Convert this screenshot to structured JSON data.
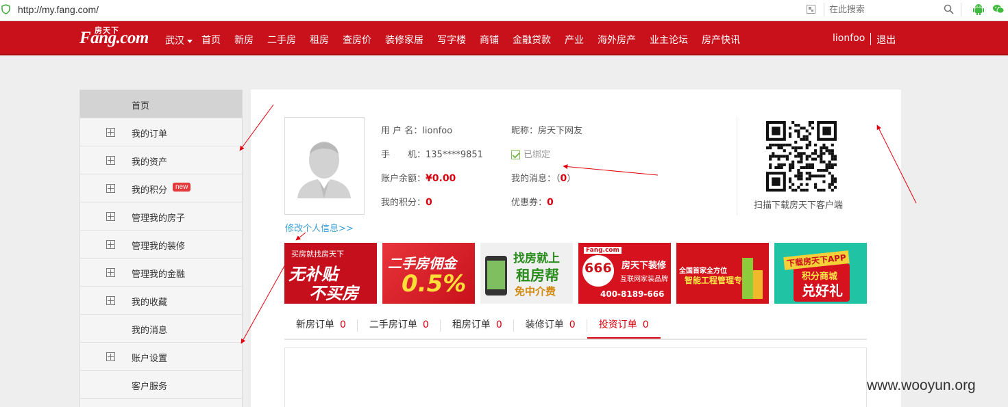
{
  "browser": {
    "url": "http://my.fang.com/",
    "search_placeholder": "在此搜索"
  },
  "header": {
    "logo_top": "房天下",
    "logo_main": "Fang.com",
    "city": "武汉",
    "nav": [
      "首页",
      "新房",
      "二手房",
      "租房",
      "查房价",
      "装修家居",
      "写字楼",
      "商铺",
      "金融贷款",
      "产业",
      "海外房产",
      "业主论坛",
      "房产快讯"
    ],
    "username": "lionfoo",
    "logout": "退出"
  },
  "sidebar": {
    "items": [
      {
        "label": "首页",
        "expandable": false,
        "active": true
      },
      {
        "label": "我的订单",
        "expandable": true
      },
      {
        "label": "我的资产",
        "expandable": true
      },
      {
        "label": "我的积分",
        "expandable": true,
        "badge": "new"
      },
      {
        "label": "管理我的房子",
        "expandable": true
      },
      {
        "label": "管理我的装修",
        "expandable": true
      },
      {
        "label": "管理我的金融",
        "expandable": true
      },
      {
        "label": "我的收藏",
        "expandable": true
      },
      {
        "label": "我的消息",
        "expandable": false
      },
      {
        "label": "账户设置",
        "expandable": true
      },
      {
        "label": "客户服务",
        "expandable": false
      }
    ]
  },
  "profile": {
    "username_label": "用 户 名：",
    "username": "lionfoo",
    "nickname_label": "昵称：",
    "nickname": "房天下网友",
    "phone_label": "手　　机：",
    "phone": "135****9851",
    "bound": "已绑定",
    "balance_label": "账户余额：",
    "balance": "¥0.00",
    "messages_label": "我的消息：",
    "messages_open": "（",
    "messages_count": "0",
    "messages_close": "）",
    "points_label": "我的积分：",
    "points": "0",
    "coupons_label": "优惠券：",
    "coupons": "0",
    "edit_link": "修改个人信息>>",
    "qr_caption": "扫描下载房天下客户端"
  },
  "banners": [
    {
      "line1": "买房就找房天下",
      "line2": "无补贴",
      "line3": "不买房"
    },
    {
      "line1": "二手房佣金",
      "line2": "0.5%"
    },
    {
      "line1": "找房就上",
      "line2": "租房帮",
      "line3": "免中介费"
    },
    {
      "line1": "Fang.com",
      "line2": "666",
      "line3": "房天下装修",
      "line4": "互联网家装品牌",
      "line5": "400-8189-666"
    },
    {
      "line1": "全国首家全方位",
      "line2": "智能工程管理专家"
    },
    {
      "line1": "下载房天下APP",
      "line2": "积分商城",
      "line3": "兑好礼"
    }
  ],
  "order_tabs": [
    {
      "label": "新房订单",
      "count": "0"
    },
    {
      "label": "二手房订单",
      "count": "0"
    },
    {
      "label": "租房订单",
      "count": "0"
    },
    {
      "label": "装修订单",
      "count": "0"
    },
    {
      "label": "投资订单",
      "count": "0",
      "active": true
    }
  ],
  "watermark": "www.wooyun.org",
  "colors": {
    "brand_red": "#c9111b",
    "accent_red": "#d6000f",
    "link_blue": "#3ca0d4"
  }
}
